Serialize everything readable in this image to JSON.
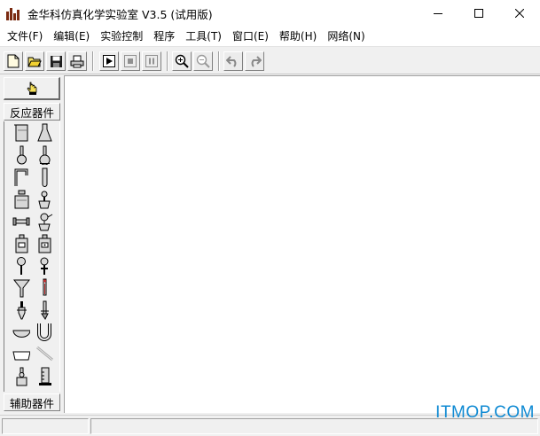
{
  "window": {
    "title": "金华科仿真化学实验室 V3.5 (试用版)",
    "controls": [
      "minimize",
      "maximize",
      "close"
    ]
  },
  "menu": [
    {
      "label": "文件(F)"
    },
    {
      "label": "编辑(E)"
    },
    {
      "label": "实验控制"
    },
    {
      "label": "程序"
    },
    {
      "label": "工具(T)"
    },
    {
      "label": "窗口(E)"
    },
    {
      "label": "帮助(H)"
    },
    {
      "label": "网络(N)"
    }
  ],
  "toolbar": {
    "buttons": [
      "new-file-icon",
      "open-folder-icon",
      "save-disk-icon",
      "print-icon",
      "play-icon",
      "stop-icon",
      "pause-icon",
      "zoom-in-icon",
      "zoom-out-icon",
      "undo-icon",
      "redo-icon"
    ]
  },
  "palette": {
    "pointer": "hand-pointer-icon",
    "group_reaction": "反应器件",
    "group_auxiliary": "辅助器件",
    "tools": [
      "beaker",
      "conical-flask",
      "round-flask",
      "flat-flask",
      "bent-tube",
      "test-tube",
      "reagent-bottle",
      "alcohol-lamp-stand",
      "tube-clamp",
      "distillation-setup",
      "gas-bottle",
      "wash-bottle",
      "dropper-funnel",
      "separatory-funnel",
      "funnel",
      "thermometer",
      "dropper",
      "burette",
      "evaporating-dish",
      "u-tube",
      "trough",
      "glass-rod",
      "kipp-generator",
      "graduated-cylinder"
    ]
  },
  "status": {
    "watermark": "ITMOP.COM"
  },
  "colors": {
    "accent_blue": "#0f8ad3",
    "icon_brown": "#7a2a10"
  }
}
